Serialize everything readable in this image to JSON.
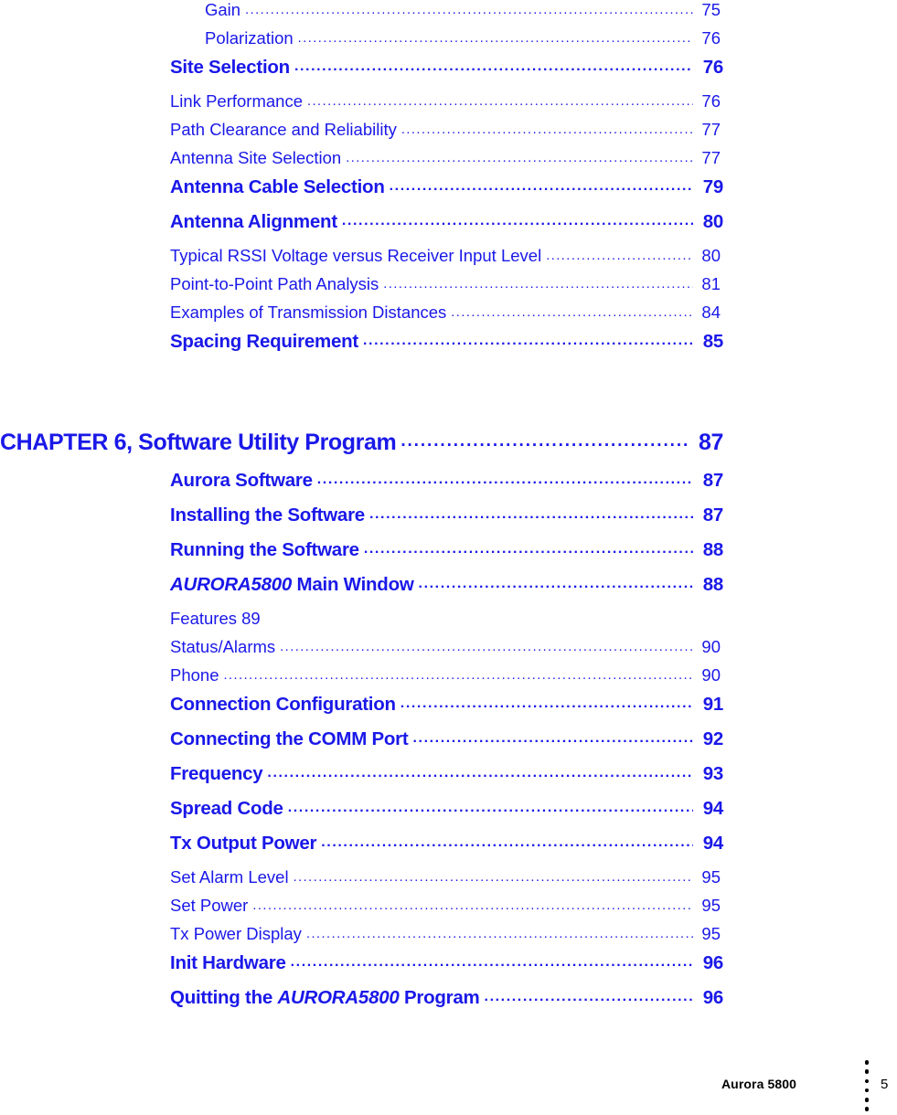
{
  "document": {
    "type": "table-of-contents",
    "page_label": "5",
    "footer_label": "Aurora 5800",
    "footer_dot_count": 6,
    "text_color": "#1a18e8",
    "footer_color": "#000000",
    "leader_char": "."
  },
  "entries": [
    {
      "level": 3,
      "title": "Gain",
      "page": "75",
      "leader": true
    },
    {
      "level": 3,
      "title": "Polarization",
      "page": "76",
      "leader": true
    },
    {
      "level": 1,
      "title": "Site Selection",
      "page": "76",
      "leader": true
    },
    {
      "level": 2,
      "title": "Link Performance",
      "page": "76",
      "leader": true
    },
    {
      "level": 2,
      "title": "Path Clearance and Reliability",
      "page": "77",
      "leader": true
    },
    {
      "level": 2,
      "title": "Antenna Site Selection",
      "page": "77",
      "leader": true
    },
    {
      "level": 1,
      "title": "Antenna Cable Selection",
      "page": "79",
      "leader": true
    },
    {
      "level": 1,
      "title": "Antenna Alignment",
      "page": "80",
      "leader": true
    },
    {
      "level": 2,
      "title": "Typical RSSI Voltage versus Receiver Input Level",
      "page": "80",
      "leader": true
    },
    {
      "level": 2,
      "title": "Point-to-Point Path Analysis",
      "page": "81",
      "leader": true
    },
    {
      "level": 2,
      "title": "Examples of Transmission Distances",
      "page": "84",
      "leader": true
    },
    {
      "level": 1,
      "title": "Spacing Requirement",
      "page": "85",
      "leader": true
    },
    {
      "level": 0,
      "title": "CHAPTER 6, Software Utility Program",
      "page": "87",
      "leader": true
    },
    {
      "level": 1,
      "title": "Aurora Software",
      "page": "87",
      "leader": true
    },
    {
      "level": 1,
      "title": "Installing the Software",
      "page": "87",
      "leader": true
    },
    {
      "level": 1,
      "title": "Running the Software",
      "page": "88",
      "leader": true
    },
    {
      "level": 1,
      "title_italic": "AURORA5800",
      "title_rest": " Main Window",
      "page": "88",
      "leader": true
    },
    {
      "level": 2,
      "title": "Features 89",
      "page": "",
      "leader": false
    },
    {
      "level": 2,
      "title": "Status/Alarms",
      "page": "90",
      "leader": true
    },
    {
      "level": 2,
      "title": "Phone",
      "page": "90",
      "leader": true
    },
    {
      "level": 1,
      "title": "Connection Configuration",
      "page": "91",
      "leader": true
    },
    {
      "level": 1,
      "title": "Connecting the COMM Port",
      "page": "92",
      "leader": true
    },
    {
      "level": 1,
      "title": "Frequency",
      "page": "93",
      "leader": true
    },
    {
      "level": 1,
      "title": "Spread Code",
      "page": "94",
      "leader": true
    },
    {
      "level": 1,
      "title": "Tx Output Power",
      "page": "94",
      "leader": true
    },
    {
      "level": 2,
      "title": "Set Alarm Level",
      "page": "95",
      "leader": true
    },
    {
      "level": 2,
      "title": "Set Power",
      "page": "95",
      "leader": true
    },
    {
      "level": 2,
      "title": "Tx Power Display",
      "page": "95",
      "leader": true
    },
    {
      "level": 1,
      "title": "Init Hardware",
      "page": "96",
      "leader": true
    },
    {
      "level": 1,
      "title_pre": "Quitting the ",
      "title_italic": "AURORA5800",
      "title_rest": " Program",
      "page": "96",
      "leader": true
    }
  ]
}
